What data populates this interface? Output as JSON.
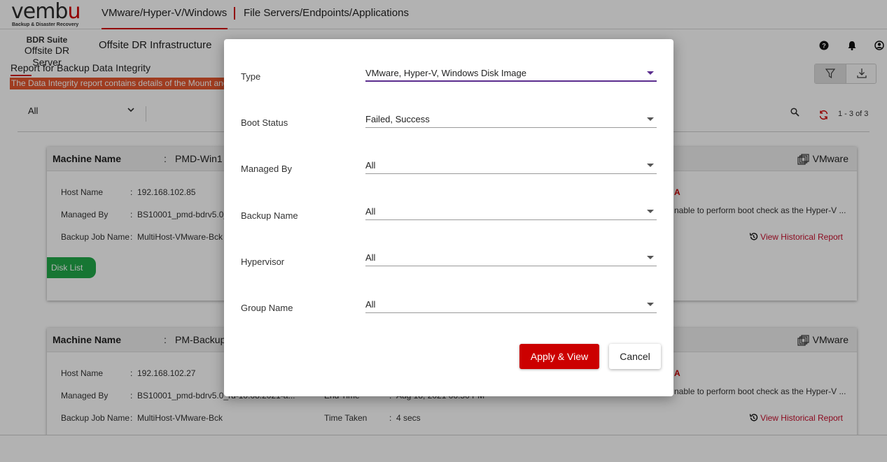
{
  "brand": {
    "wordmark_a": "vemb",
    "wordmark_b": "u",
    "tagline": "Backup & Disaster Recovery"
  },
  "nav": {
    "tabs": [
      {
        "label": "VMware/Hyper-V/Windows",
        "active": true
      },
      {
        "label": "File Servers/Endpoints/Applications",
        "active": false
      }
    ],
    "accent": "#d10000"
  },
  "product": {
    "line1": "BDR Suite",
    "line2": "Offsite DR Server"
  },
  "subnav": {
    "label": "Offsite DR Infrastructure"
  },
  "header_icons": [
    "help-icon",
    "bell-icon",
    "user-icon"
  ],
  "report": {
    "title": "Report for Backup Data Integrity",
    "banner": "The Data Integrity report contains details of the Mount and"
  },
  "toolbar": {
    "filter_icon": "filter-icon",
    "download_icon": "download-icon"
  },
  "list_controls": {
    "status_filter": "All",
    "pager": "1 - 3 of 3"
  },
  "cards": [
    {
      "machine_label": "Machine Name",
      "machine_value": "PMD-Win1",
      "platform": "VMware",
      "rows": [
        {
          "label": "Host Name",
          "value": "192.168.102.85"
        },
        {
          "label": "Managed By",
          "value": "BS10001_pmd-bdrv5.0_"
        },
        {
          "label": "Backup Job Name",
          "value": "MultiHost-VMware-Bck"
        }
      ],
      "status_fragment": "A",
      "message": "nable to perform boot check as the Hyper-V ...",
      "history_link": "View Historical Report",
      "disk_tab": "Disk List"
    },
    {
      "machine_label": "Machine Name",
      "machine_value": "PM-Backup",
      "platform": "VMware",
      "rows": [
        {
          "label": "Host Name",
          "value": "192.168.102.27"
        },
        {
          "label": "Managed By",
          "value": "BS10001_pmd-bdrv5.0_rd-10.08.2021-a..."
        },
        {
          "label": "Backup Job Name",
          "value": "MultiHost-VMware-Bck"
        }
      ],
      "rows_right": [
        {
          "label": "End Time",
          "value": "Aug 18, 2021 06:50 PM"
        },
        {
          "label": "Time Taken",
          "value": "4 secs"
        }
      ],
      "status_fragment": "A",
      "message": "nable to perform boot check as the Hyper-V ...",
      "history_link": "View Historical Report"
    }
  ],
  "modal": {
    "fields": [
      {
        "label": "Type",
        "value": "VMware, Hyper-V, Windows Disk Image",
        "active": true
      },
      {
        "label": "Boot Status",
        "value": "Failed, Success"
      },
      {
        "label": "Managed By",
        "value": "All"
      },
      {
        "label": "Backup Name",
        "value": "All"
      },
      {
        "label": "Hypervisor",
        "value": "All"
      },
      {
        "label": "Group Name",
        "value": "All"
      }
    ],
    "apply_label": "Apply & View",
    "cancel_label": "Cancel",
    "active_color": "#5b2d8e",
    "apply_color": "#cc0000"
  }
}
